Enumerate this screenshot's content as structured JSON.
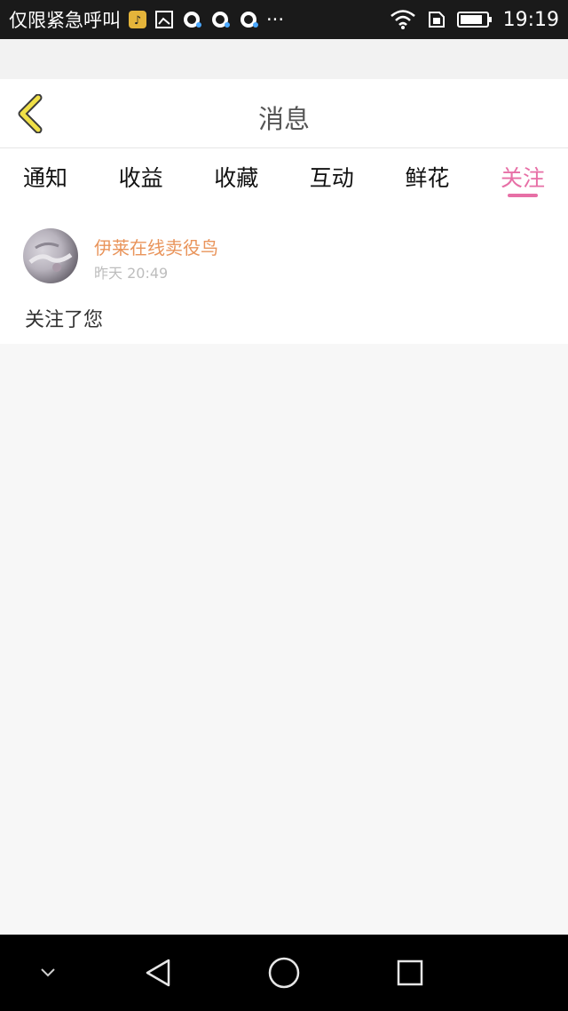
{
  "status_bar": {
    "left_text": "仅限紧急呼叫",
    "overflow": "···",
    "time": "19:19"
  },
  "header": {
    "title": "消息"
  },
  "tabs": [
    {
      "label": "通知",
      "active": false
    },
    {
      "label": "收益",
      "active": false
    },
    {
      "label": "收藏",
      "active": false
    },
    {
      "label": "互动",
      "active": false
    },
    {
      "label": "鲜花",
      "active": false
    },
    {
      "label": "关注",
      "active": true
    }
  ],
  "messages": [
    {
      "user": "伊莱在线卖役鸟",
      "time": "昨天 20:49",
      "text": "关注了您"
    }
  ],
  "colors": {
    "accent": "#e76fa6",
    "username": "#e9945b",
    "back_arrow": "#f0e047"
  }
}
